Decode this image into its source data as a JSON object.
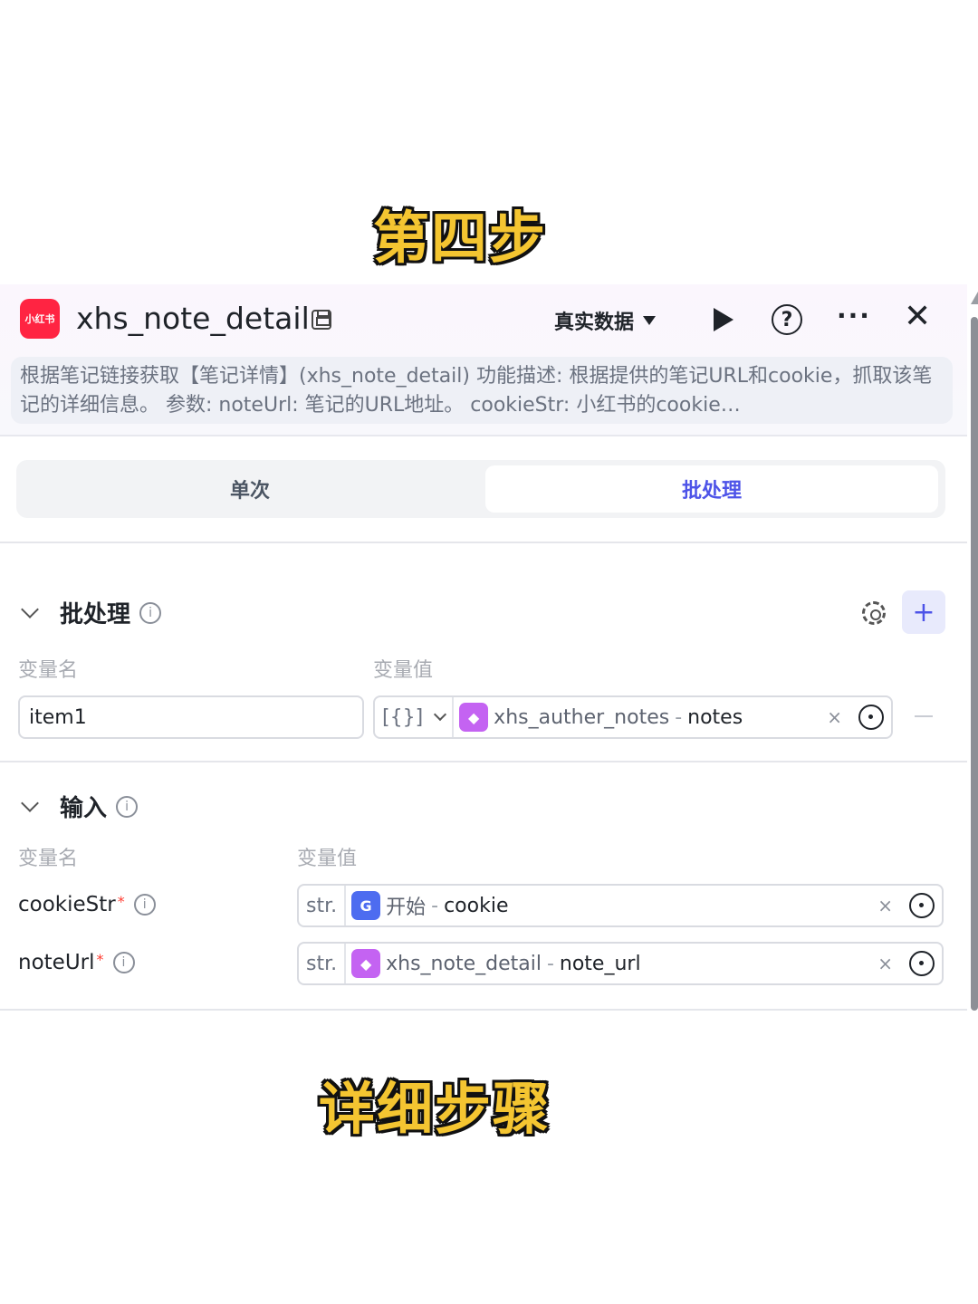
{
  "captions": {
    "top": "第四步",
    "bottom": "详细步骤"
  },
  "header": {
    "logo_text": "小红书",
    "title": "xhs_note_detail",
    "mode_label": "真实数据",
    "help_glyph": "?",
    "more_glyph": "···",
    "close_glyph": "✕",
    "description": "根据笔记链接获取【笔记详情】(xhs_note_detail) 功能描述: 根据提供的笔记URL和cookie，抓取该笔记的详细信息。 参数: noteUrl: 笔记的URL地址。 cookieStr: 小红书的cookie…"
  },
  "tabs": {
    "single": "单次",
    "batch": "批处理"
  },
  "batch": {
    "title": "批处理",
    "col_name": "变量名",
    "col_value": "变量值",
    "add_glyph": "+",
    "row": {
      "name": "item1",
      "type": "[{}]",
      "ref_node": "xhs_auther_notes",
      "ref_sep": "-",
      "ref_field": "notes",
      "clear": "×"
    }
  },
  "input": {
    "title": "输入",
    "col_name": "变量名",
    "col_value": "变量值",
    "params": [
      {
        "name": "cookieStr",
        "req": "*",
        "type": "str.",
        "ref_node": "开始",
        "ref_sep": "-",
        "ref_field": "cookie",
        "clear": "×",
        "icon": "G"
      },
      {
        "name": "noteUrl",
        "req": "*",
        "type": "str.",
        "ref_node": "xhs_note_detail",
        "ref_sep": "-",
        "ref_field": "note_url",
        "clear": "×",
        "icon": "◆"
      }
    ]
  },
  "info_glyph": "i",
  "colors": {
    "accent": "#4d53e8",
    "logo": "#ff2442",
    "cube": "#c463f2",
    "start": "#4d6cf0",
    "caption": "#f4c531"
  }
}
